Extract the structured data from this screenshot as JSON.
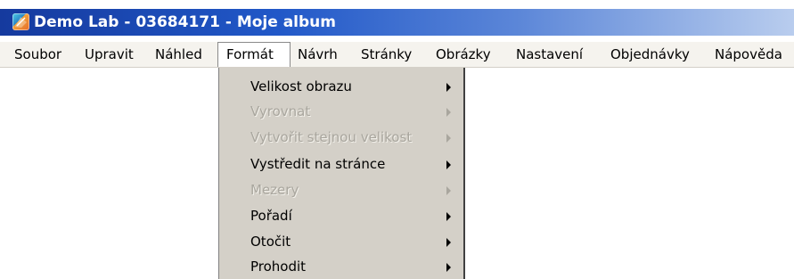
{
  "window": {
    "title": "Demo Lab - 03684171 - Moje album",
    "icon": "app-logo-icon"
  },
  "menubar": {
    "items": [
      {
        "label": "Soubor"
      },
      {
        "label": "Upravit"
      },
      {
        "label": "Náhled"
      },
      {
        "label": "Formát",
        "active": true
      },
      {
        "label": "Návrh"
      },
      {
        "label": "Stránky"
      },
      {
        "label": "Obrázky"
      },
      {
        "label": "Nastavení"
      },
      {
        "label": "Objednávky"
      },
      {
        "label": "Nápověda"
      }
    ]
  },
  "format_menu": {
    "items": [
      {
        "label": "Velikost obrazu",
        "enabled": true,
        "submenu": true
      },
      {
        "label": "Vyrovnat",
        "enabled": false,
        "submenu": true
      },
      {
        "label": "Vytvořit stejnou velikost",
        "enabled": false,
        "submenu": true
      },
      {
        "label": "Vystředit na stránce",
        "enabled": true,
        "submenu": true
      },
      {
        "label": "Mezery",
        "enabled": false,
        "submenu": true
      },
      {
        "label": "Pořadí",
        "enabled": true,
        "submenu": true
      },
      {
        "label": "Otočit",
        "enabled": true,
        "submenu": true
      },
      {
        "label": "Prohodit",
        "enabled": true,
        "submenu": true
      }
    ]
  },
  "colors": {
    "title_gradient_start": "#153a9e",
    "title_gradient_end": "#b9cdee",
    "menu_background": "#d4d0c8",
    "disabled_text": "#a9a69e"
  }
}
